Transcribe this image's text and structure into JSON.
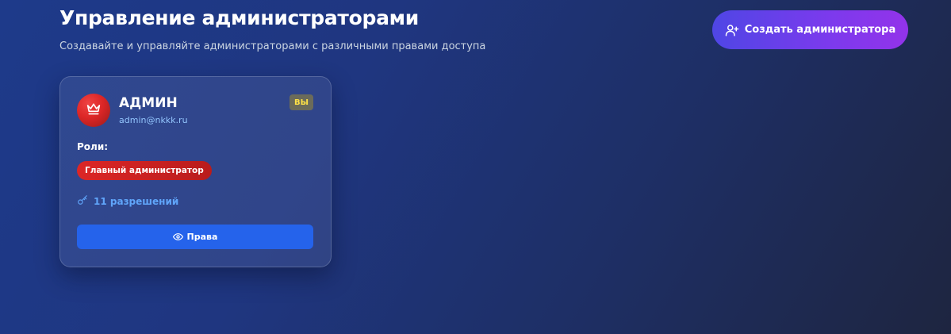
{
  "header": {
    "title": "Управление администраторами",
    "subtitle": "Создавайте и управляйте администраторами с различными правами доступа",
    "create_button": {
      "label": "Создать администратора",
      "icon": "user-plus-icon"
    }
  },
  "admins": [
    {
      "avatar_icon": "crown-icon",
      "name": "АДМИН",
      "email": "admin@nkkk.ru",
      "self_badge": "ВЫ",
      "roles_label": "Роли:",
      "roles": [
        "Главный администратор"
      ],
      "permissions_icon": "key-icon",
      "permissions_text": "11 разрешений",
      "rights_button": {
        "label": "Права",
        "icon": "eye-icon"
      }
    }
  ],
  "colors": {
    "accent_blue": "#2563eb",
    "role_red": "#dc2626",
    "gradient_purple": "#9333ea",
    "badge_yellow": "#fde047",
    "link_blue": "#60a5fa"
  }
}
